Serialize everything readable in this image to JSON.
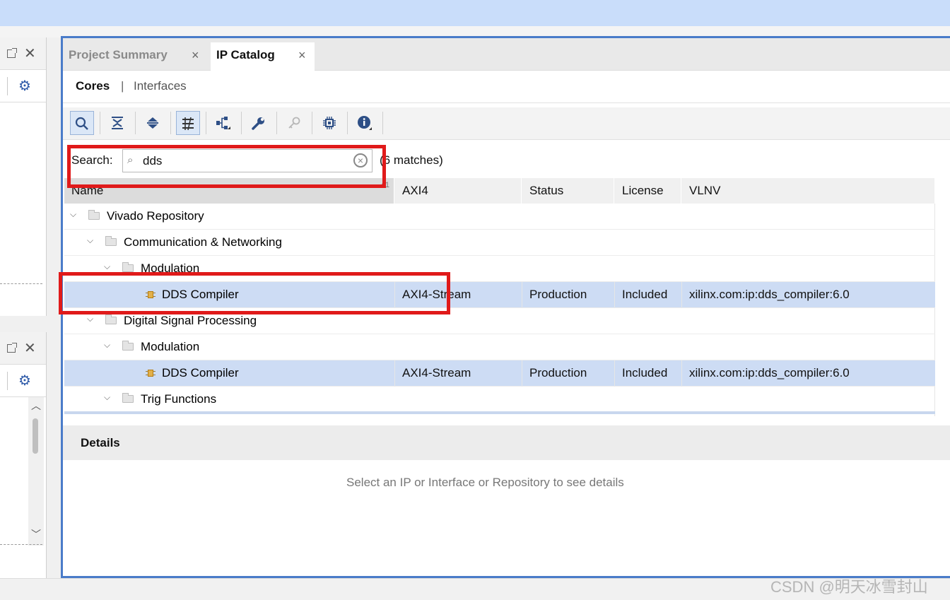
{
  "tabs": [
    {
      "label": "Project Summary",
      "active": false
    },
    {
      "label": "IP Catalog",
      "active": true
    }
  ],
  "subnav": {
    "cores": "Cores",
    "separator": "|",
    "interfaces": "Interfaces"
  },
  "toolbar_icons": [
    "search-icon",
    "collapse-all-icon",
    "expand-all-icon",
    "filter-icon",
    "hierarchy-icon",
    "wrench-icon",
    "key-icon",
    "chip-icon",
    "info-icon"
  ],
  "search": {
    "label": "Search:",
    "value": "dds",
    "matches": "(6 matches)"
  },
  "table": {
    "columns": [
      "Name",
      "AXI4",
      "Status",
      "License",
      "VLNV"
    ],
    "sort_marker": "^1",
    "rows": [
      {
        "level": 0,
        "type": "folder",
        "name": "Vivado Repository"
      },
      {
        "level": 1,
        "type": "folder",
        "name": "Communication & Networking"
      },
      {
        "level": 2,
        "type": "folder",
        "name": "Modulation"
      },
      {
        "level": 3,
        "type": "ip",
        "name": "DDS Compiler",
        "axi4": "AXI4-Stream",
        "status": "Production",
        "license": "Included",
        "vlnv": "xilinx.com:ip:dds_compiler:6.0",
        "selected": true
      },
      {
        "level": 1,
        "type": "folder",
        "name": "Digital Signal Processing"
      },
      {
        "level": 2,
        "type": "folder",
        "name": "Modulation"
      },
      {
        "level": 3,
        "type": "ip",
        "name": "DDS Compiler",
        "axi4": "AXI4-Stream",
        "status": "Production",
        "license": "Included",
        "vlnv": "xilinx.com:ip:dds_compiler:6.0",
        "selected": true
      },
      {
        "level": 2,
        "type": "folder",
        "name": "Trig Functions"
      }
    ]
  },
  "details": {
    "title": "Details",
    "empty_message": "Select an IP or Interface or Repository to see details"
  },
  "watermark": "CSDN @明天冰雪封山",
  "colors": {
    "selection": "#cddcf4",
    "annotation": "#e01a1a",
    "frame": "#4a7cc9"
  }
}
